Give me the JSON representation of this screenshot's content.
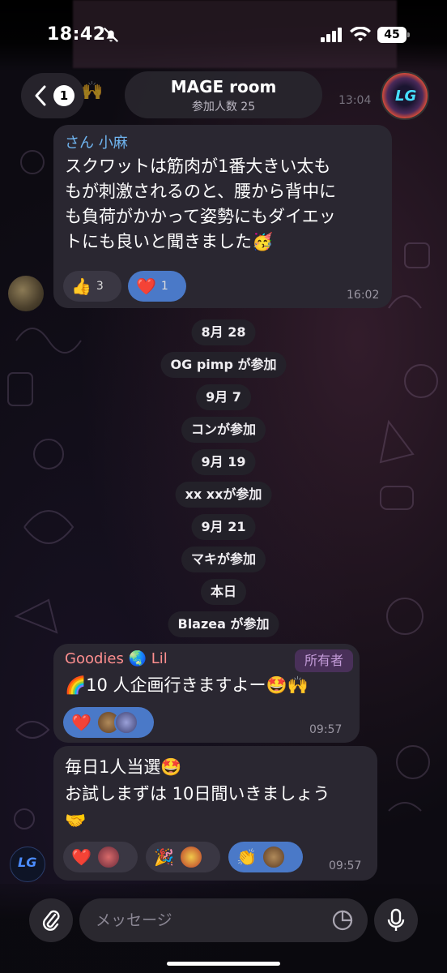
{
  "status_bar": {
    "time": "18:42",
    "battery": "45"
  },
  "header": {
    "back_count": "1",
    "title": "MAGE room",
    "subtitle": "参加人数 25",
    "avatar_text": "LG",
    "peek_time": "13:04"
  },
  "messages": [
    {
      "sender": "さん 小麻",
      "lines": [
        "スクワットは筋肉が1番大きい太も",
        "もが刺激されるのと、腰から背中に",
        "も負荷がかかって姿勢にもダイエッ",
        "トにも良いと聞きました🥳"
      ],
      "reactions": [
        {
          "emoji": "👍",
          "count": "3",
          "mine": false
        },
        {
          "emoji": "❤️",
          "count": "1",
          "mine": true
        }
      ],
      "time": "16:02"
    },
    {
      "sender": "Goodies 🌏 Lil",
      "badge": "所有者",
      "lines": [
        "🌈10 人企画行きますよー🤩🙌"
      ],
      "reactions": [
        {
          "emoji": "❤️",
          "mine": true
        }
      ],
      "time": "09:57"
    },
    {
      "lines": [
        "毎日1人当選🤩",
        "お試しまずは 10日間いきましょう",
        "🤝"
      ],
      "reactions": [
        {
          "emoji": "❤️",
          "mine": false
        },
        {
          "emoji": "🎉",
          "mine": false
        },
        {
          "emoji": "👏",
          "mine": true
        }
      ],
      "time": "09:57"
    }
  ],
  "service_messages": [
    "8月 28",
    "OG pimp が参加",
    "9月 7",
    "コンが参加",
    "9月 19",
    "xx xxが参加",
    "9月 21",
    "マキが参加",
    "本日",
    "Blazea が参加"
  ],
  "input": {
    "placeholder": "メッセージ"
  },
  "colors": {
    "bubble": "#2a2731",
    "sender_blue": "#6fb4ef",
    "sender_owner": "#ff8f8f",
    "reaction_mine": "#4a79c8"
  }
}
